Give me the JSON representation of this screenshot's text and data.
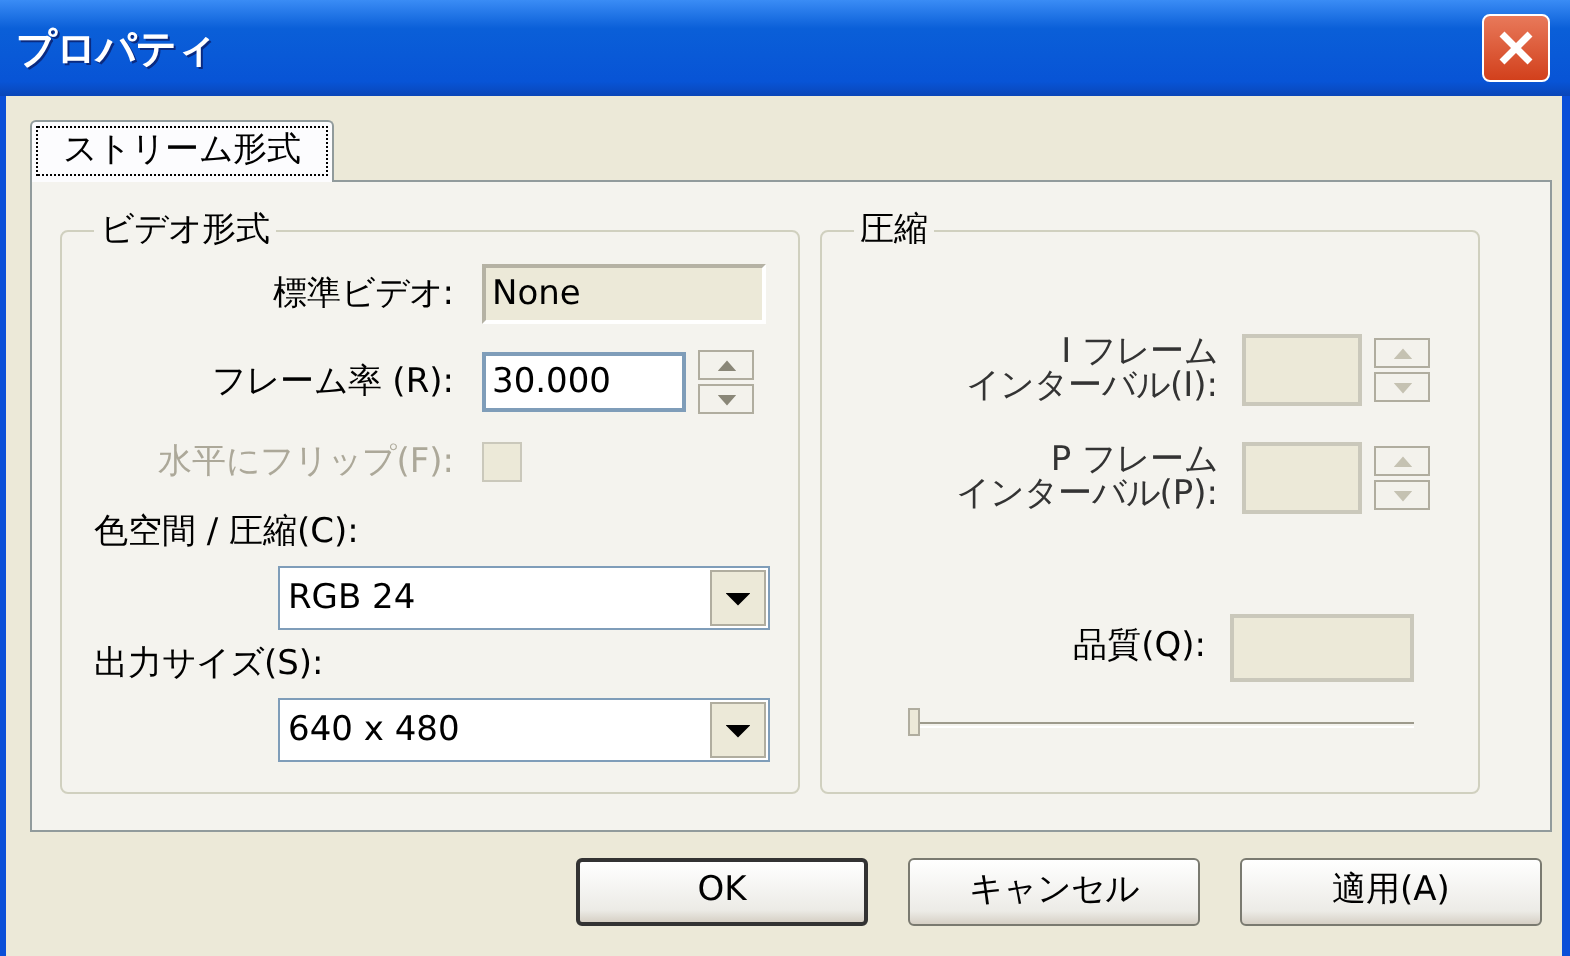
{
  "window": {
    "title": "プロパティ"
  },
  "tabs": [
    {
      "label": "ストリーム形式",
      "selected": true
    }
  ],
  "video_format": {
    "title": "ビデオ形式",
    "rows": [
      {
        "kind": "readonly",
        "label": "標準ビデオ:",
        "value": "None"
      },
      {
        "kind": "spin",
        "label": "フレーム率 (R):",
        "value": "30.000",
        "disabled": false
      },
      {
        "kind": "checkbox",
        "label": "水平にフリップ(F):",
        "checked": false,
        "disabled": true
      },
      {
        "kind": "combo",
        "label": "色空間 / 圧縮(C):",
        "value": "RGB 24"
      },
      {
        "kind": "combo",
        "label": "出力サイズ(S):",
        "value": "640 x 480"
      }
    ]
  },
  "compression": {
    "title": "圧縮",
    "rows": [
      {
        "kind": "spin",
        "label_lines": [
          "I フレーム",
          "インターバル(I):"
        ],
        "disabled": true
      },
      {
        "kind": "spin",
        "label_lines": [
          "P フレーム",
          "インターバル(P):"
        ],
        "disabled": true
      },
      {
        "kind": "field",
        "label": "品質(Q):",
        "disabled": true
      },
      {
        "kind": "slider",
        "level": 0,
        "disabled": true
      }
    ]
  },
  "buttons": [
    {
      "label": "OK",
      "default": true
    },
    {
      "label": "キャンセル",
      "default": false
    },
    {
      "label": "適用(A)",
      "default": false
    }
  ]
}
